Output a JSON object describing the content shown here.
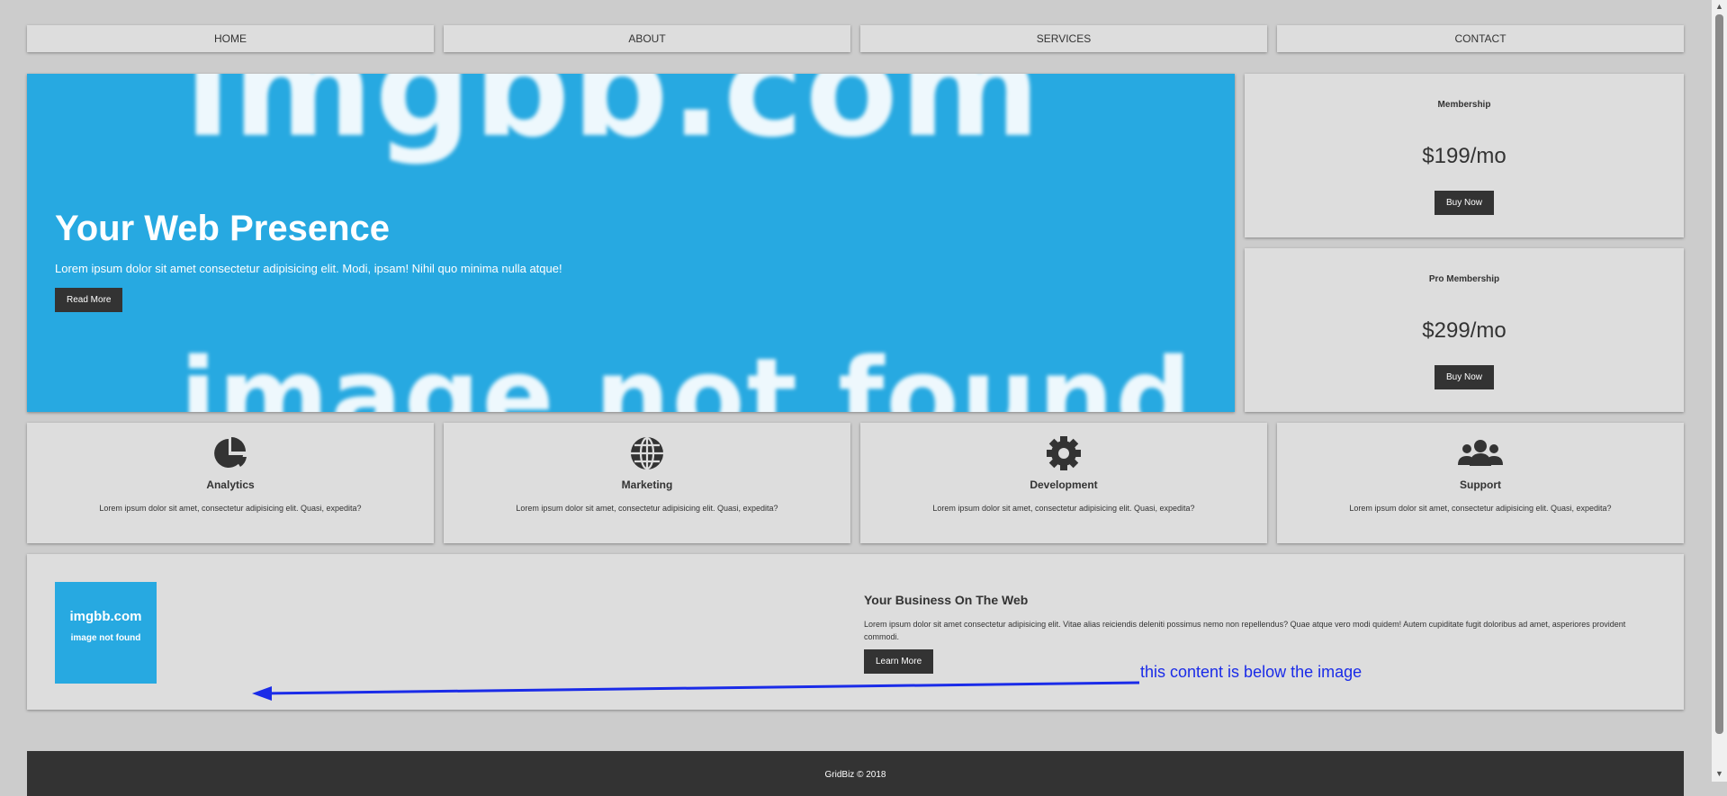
{
  "nav": {
    "items": [
      {
        "label": "HOME"
      },
      {
        "label": "ABOUT"
      },
      {
        "label": "SERVICES"
      },
      {
        "label": "CONTACT"
      }
    ]
  },
  "showcase": {
    "image_top_text": "imgbb.com",
    "image_bottom_text": "image not found",
    "title": "Your Web Presence",
    "text": "Lorem ipsum dolor sit amet consectetur adipisicing elit. Modi, ipsam! Nihil quo minima nulla atque!",
    "button": "Read More",
    "background_color": "#27a9e1"
  },
  "sidebar": [
    {
      "title": "Membership",
      "price": "$199/mo",
      "button": "Buy Now"
    },
    {
      "title": "Pro Membership",
      "price": "$299/mo",
      "button": "Buy Now"
    }
  ],
  "boxes": [
    {
      "icon": "pie-chart-icon",
      "title": "Analytics",
      "text": "Lorem ipsum dolor sit amet, consectetur adipisicing elit. Quasi, expedita?"
    },
    {
      "icon": "globe-icon",
      "title": "Marketing",
      "text": "Lorem ipsum dolor sit amet, consectetur adipisicing elit. Quasi, expedita?"
    },
    {
      "icon": "gear-icon",
      "title": "Development",
      "text": "Lorem ipsum dolor sit amet, consectetur adipisicing elit. Quasi, expedita?"
    },
    {
      "icon": "users-icon",
      "title": "Support",
      "text": "Lorem ipsum dolor sit amet, consectetur adipisicing elit. Quasi, expedita?"
    }
  ],
  "info": {
    "image_line1": "imgbb.com",
    "image_line2": "image not found",
    "title": "Your Business On The Web",
    "text": "Lorem ipsum dolor sit amet consectetur adipisicing elit. Vitae alias reiciendis deleniti possimus nemo non repellendus? Quae atque vero modi quidem! Autem cupiditate fugit doloribus ad amet, asperiores provident commodi.",
    "button": "Learn More"
  },
  "annotation": {
    "text": "this content is below the image",
    "color": "#1a2be8"
  },
  "footer": {
    "text": "GridBiz © 2018"
  },
  "colors": {
    "background": "#cccccc",
    "panel": "#dddddd",
    "dark": "#333333",
    "accent": "#27a9e1"
  }
}
